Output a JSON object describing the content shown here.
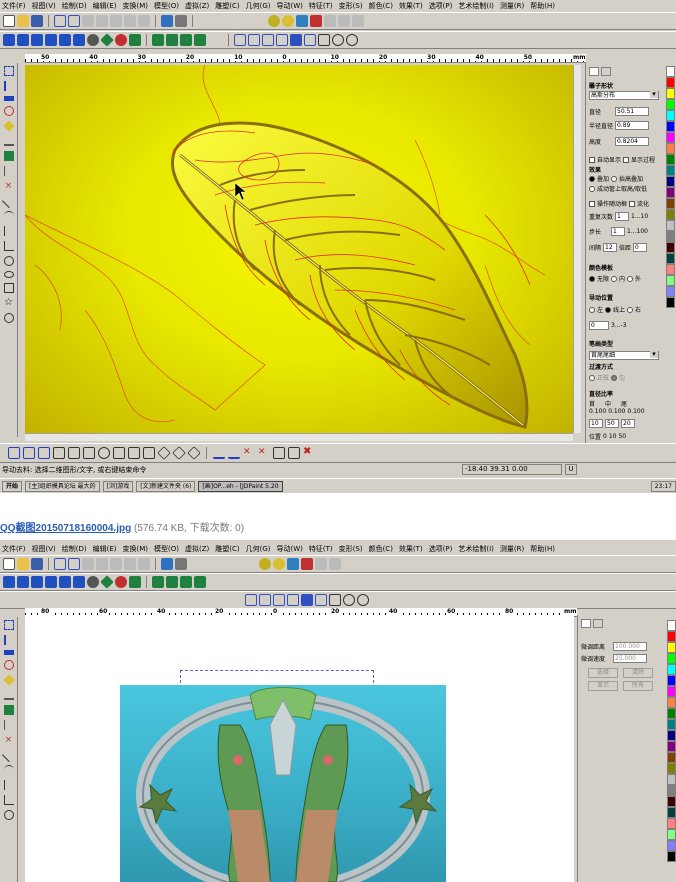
{
  "screen1": {
    "menu": [
      "文件(F)",
      "视图(V)",
      "绘制(D)",
      "编辑(E)",
      "变换(M)",
      "模型(O)",
      "虚拟(Z)",
      "雕塑(C)",
      "几何(G)",
      "导动(W)",
      "特征(T)",
      "变形(S)",
      "颜色(C)",
      "效果(T)",
      "选项(P)",
      "艺术绘制(I)",
      "测量(R)",
      "帮助(H)"
    ],
    "ruler_labels": [
      "50",
      "40",
      "30",
      "20",
      "10",
      "0",
      "10",
      "20",
      "30",
      "40",
      "50"
    ],
    "ruler_unit": "mm",
    "panel": {
      "group_brush": "雕子形状",
      "brush_select": "高斯分布",
      "fields": [
        {
          "label": "直径",
          "value": "50.51"
        },
        {
          "label": "半径直径",
          "value": "0.89"
        },
        {
          "label": "高度",
          "value": "0.8204"
        }
      ],
      "opt_autoshow": "自动显示",
      "opt_showfilter": "显示过程",
      "group_mode": "效果",
      "mode_stack": "叠加",
      "mode_level": "抬高叠加",
      "mode_apex": "成动管上取高/取低",
      "opt_follow": "操作随动框",
      "opt_smooth": "流化",
      "repeat_label": "重复次数",
      "repeat_value": "1",
      "repeat_range": "1...10",
      "step_label": "步长",
      "step_value": "1",
      "step_range": "1...100",
      "interval_label": "间隔",
      "interval_value": "12",
      "scale_label": "倍距",
      "scale_value": "0",
      "group_color": "颜色模板",
      "color_none": "无限",
      "color_in": "内",
      "color_out": "外",
      "group_guide": "导动位置",
      "guide_left": "左",
      "guide_on": "线上",
      "guide_right": "右",
      "guide_value": "0",
      "guide_range": "3...-3",
      "group_pen": "笔画类型",
      "pen_select": "首尾尾细",
      "group_transition": "过渡方式",
      "trans_a": "正弦",
      "trans_b": "匀",
      "group_ratio": "直径比率",
      "ratio_cols": [
        "首",
        "中",
        "尾"
      ],
      "ratio_values": [
        "0.100",
        "0.100",
        "0.100"
      ],
      "ratio_inputs": [
        "10",
        "50",
        "20"
      ],
      "pos_label": "位置",
      "pos_values": [
        "0",
        "10",
        "50"
      ]
    },
    "status_message": "导动去料: 选择二维图形/文字, 或右键结束命令",
    "coords": "-18.40  39.31  0.00",
    "unit": "U",
    "taskbar": {
      "start": "开始",
      "tasks": [
        "[主]组织模具论坛 最大的",
        "[浏]游戏",
        "[文]新建文件夹 (6)",
        "[画]OP...eh - [JDPaint 5.20"
      ],
      "tray_time": "23:17"
    }
  },
  "caption": {
    "filename": "QQ截图20150718160004.jpg",
    "meta": "(576.74 KB, 下载次数: 0)"
  },
  "screen2": {
    "menu": [
      "文件(F)",
      "视图(V)",
      "绘制(D)",
      "编辑(E)",
      "变换(M)",
      "模型(O)",
      "虚拟(Z)",
      "雕塑(C)",
      "几何(G)",
      "导动(W)",
      "特征(T)",
      "变形(S)",
      "颜色(C)",
      "效果(T)",
      "选项(P)",
      "艺术绘制(I)",
      "测量(R)",
      "帮助(H)"
    ],
    "ruler_labels": [
      "80",
      "60",
      "40",
      "20",
      "0",
      "20",
      "40",
      "60",
      "80"
    ],
    "ruler_unit": "mm",
    "panel": {
      "fine_height_label": "微调距离",
      "fine_height_value": "100.000",
      "fine_speed_label": "微调速度",
      "fine_speed_value": "25.000",
      "btn_select": "选择",
      "btn_pick": "清除",
      "btn_show": "显示",
      "btn_all": "所有"
    }
  },
  "palette_colors": [
    "#ffffff",
    "#ff0000",
    "#ffff00",
    "#00ff00",
    "#00ffff",
    "#0000ff",
    "#ff00ff",
    "#ff8040",
    "#008000",
    "#008080",
    "#000080",
    "#800080",
    "#804000",
    "#808000",
    "#c0c0c0",
    "#808080",
    "#400000",
    "#004040",
    "#ff8080",
    "#80ff80",
    "#8080ff",
    "#000000"
  ]
}
